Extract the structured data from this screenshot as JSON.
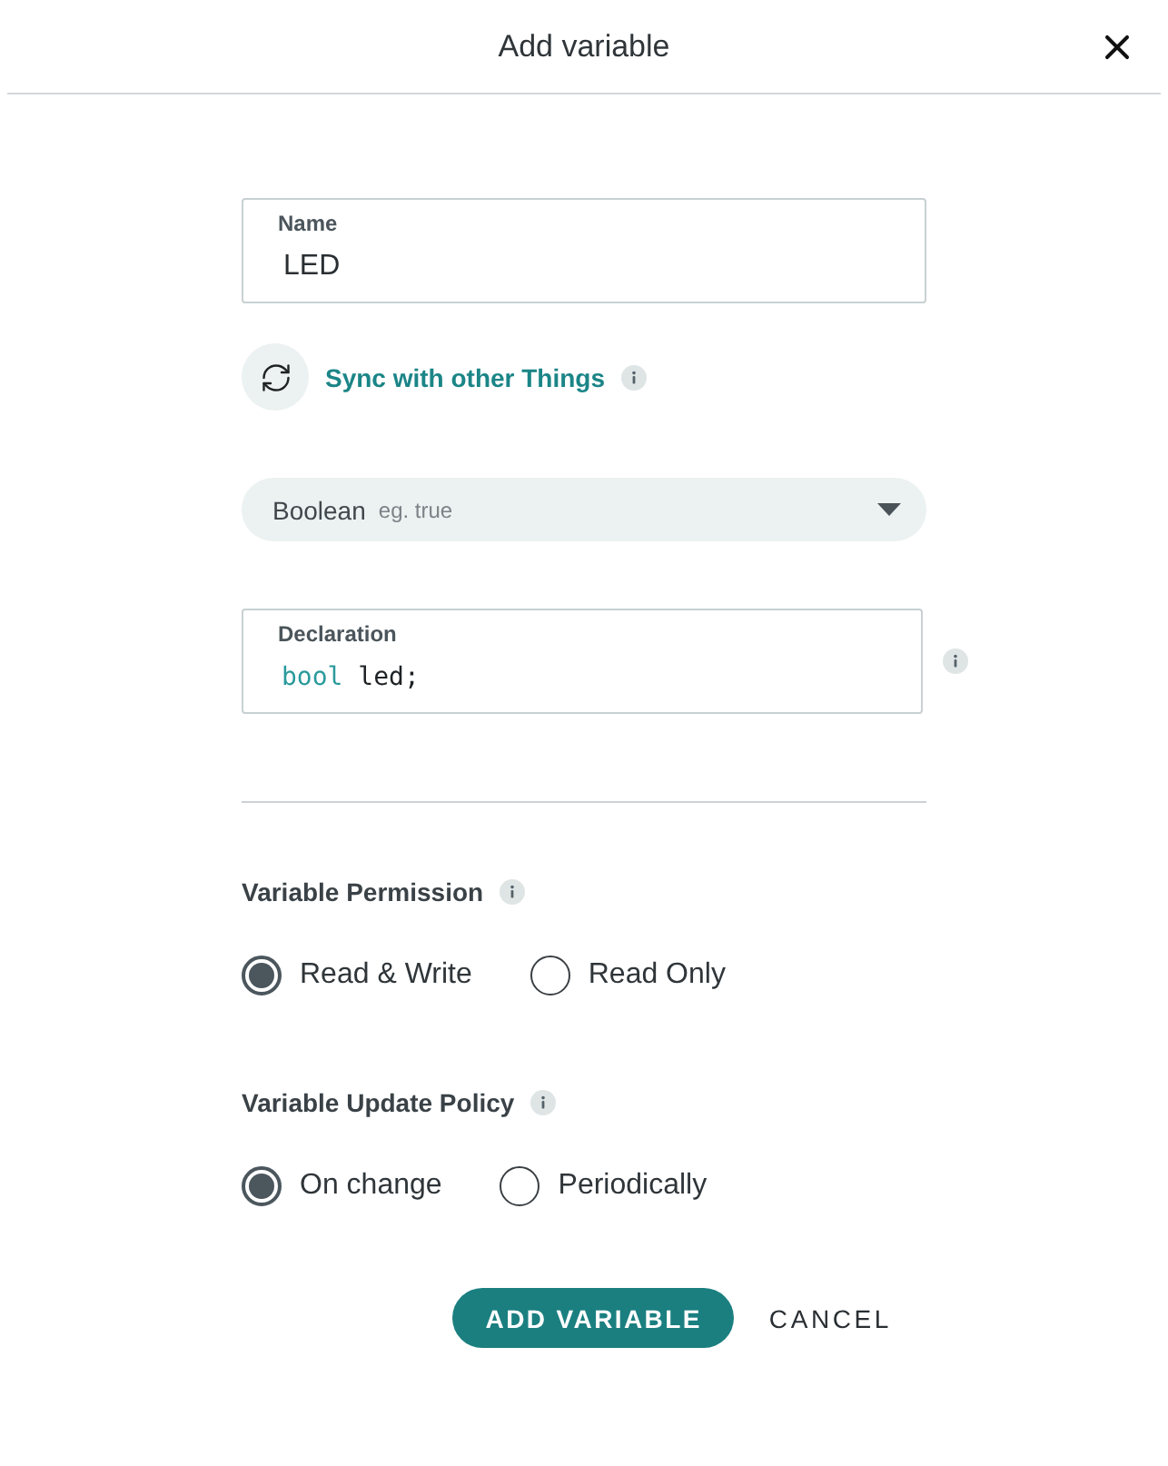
{
  "window": {
    "title": "Add variable"
  },
  "name_field": {
    "label": "Name",
    "value": "LED"
  },
  "sync": {
    "label": "Sync with other Things"
  },
  "type_select": {
    "value": "Boolean",
    "example": "eg. true"
  },
  "declaration": {
    "label": "Declaration",
    "tokens": [
      {
        "kind": "keyword",
        "text": "bool"
      },
      {
        "kind": "identifier",
        "text": "led"
      },
      {
        "kind": "punctuation",
        "text": ";"
      }
    ]
  },
  "permission": {
    "label": "Variable Permission",
    "options": [
      {
        "label": "Read & Write",
        "selected": true
      },
      {
        "label": "Read Only",
        "selected": false
      }
    ]
  },
  "update_policy": {
    "label": "Variable Update Policy",
    "options": [
      {
        "label": "On change",
        "selected": true
      },
      {
        "label": "Periodically",
        "selected": false
      }
    ]
  },
  "buttons": [
    {
      "label": "ADD VARIABLE",
      "kind": "primary"
    },
    {
      "label": "CANCEL",
      "kind": "text"
    }
  ]
}
